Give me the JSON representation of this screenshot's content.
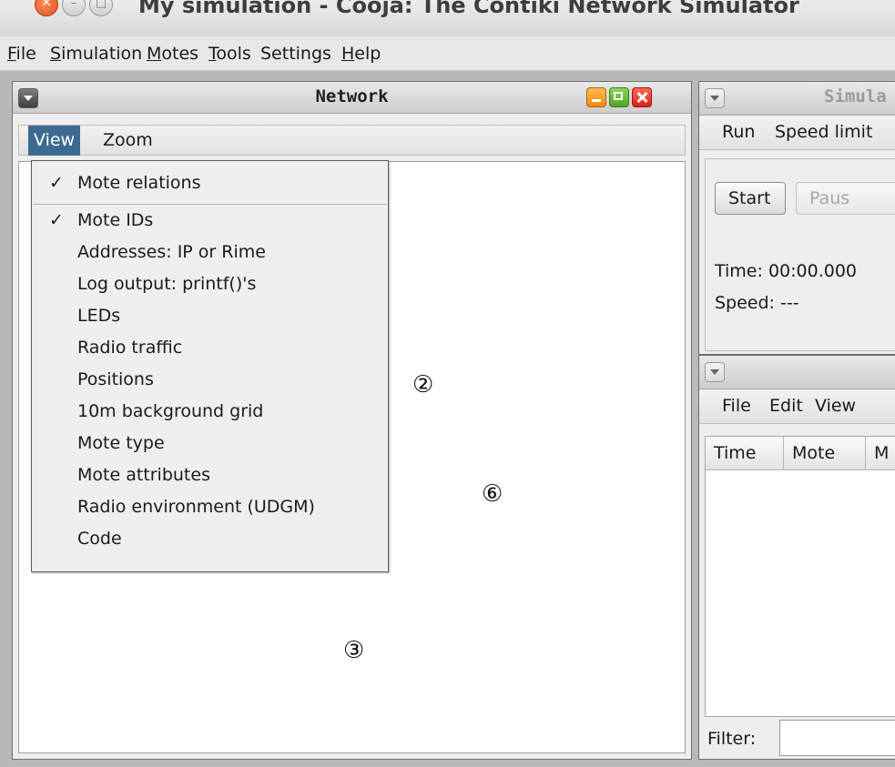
{
  "window": {
    "title": "My simulation - Cooja: The Contiki Network Simulator"
  },
  "menubar": [
    "File",
    "Simulation",
    "Motes",
    "Tools",
    "Settings",
    "Help"
  ],
  "network": {
    "title": "Network",
    "menu": [
      "View",
      "Zoom"
    ],
    "view_menu": [
      {
        "label": "Mote relations",
        "checked": true
      },
      {
        "label": "Mote IDs",
        "checked": true
      },
      {
        "label": "Addresses: IP or Rime",
        "checked": false
      },
      {
        "label": "Log output: printf()'s",
        "checked": false
      },
      {
        "label": "LEDs",
        "checked": false
      },
      {
        "label": "Radio traffic",
        "checked": false
      },
      {
        "label": "Positions",
        "checked": false
      },
      {
        "label": "10m background grid",
        "checked": false
      },
      {
        "label": "Mote type",
        "checked": false
      },
      {
        "label": "Mote attributes",
        "checked": false
      },
      {
        "label": "Radio environment (UDGM)",
        "checked": false
      },
      {
        "label": "Code",
        "checked": false
      }
    ],
    "check_mark": "✓",
    "motes": [
      "②",
      "⑥",
      "③"
    ]
  },
  "simulation": {
    "title": "Simula",
    "menu": [
      "Run",
      "Speed limit"
    ],
    "start": "Start",
    "pause": "Paus",
    "time": "Time: 00:00.000",
    "speed": "Speed: ---"
  },
  "log": {
    "menu": [
      "File",
      "Edit",
      "View"
    ],
    "columns": [
      "Time",
      "Mote",
      "M"
    ],
    "filter_label": "Filter:",
    "filter_value": ""
  },
  "colors": {
    "selection": "#3d6a92",
    "close": "#d8201a",
    "minimize": "#f08a0c",
    "maximize": "#4fa524"
  }
}
